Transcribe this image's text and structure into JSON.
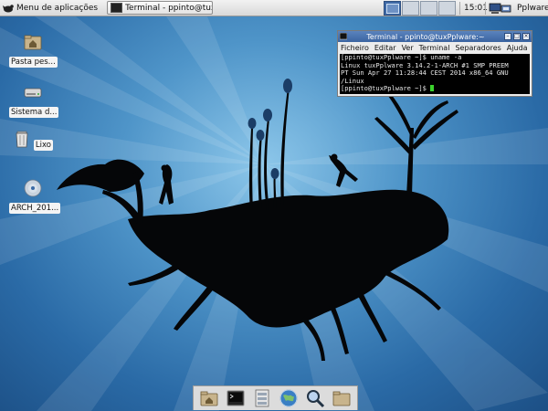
{
  "panel": {
    "app_menu_label": "Menu de aplicações",
    "task_label": "Terminal - ppinto@tuxPp...",
    "workspaces": [
      {
        "active": true
      },
      {
        "active": false
      },
      {
        "active": false
      },
      {
        "active": false
      }
    ],
    "clock": "15:01",
    "user": "Pplware"
  },
  "desktop_icons": [
    {
      "label": "Pasta pes...",
      "icon": "home-folder-icon"
    },
    {
      "label": "Sistema d...",
      "icon": "drive-icon"
    },
    {
      "label": "Lixo",
      "icon": "trash-icon"
    },
    {
      "label": "ARCH_201...",
      "icon": "cd-icon"
    }
  ],
  "terminal": {
    "title": "Terminal - ppinto@tuxPplware:~",
    "menu": [
      "Ficheiro",
      "Editar",
      "Ver",
      "Terminal",
      "Separadores",
      "Ajuda"
    ],
    "lines": [
      "[ppinto@tuxPplware ~]$ uname -a",
      "Linux tuxPplware 3.14.2-1-ARCH #1 SMP PREEM",
      "PT Sun Apr 27 11:28:44 CEST 2014 x86_64 GNU",
      "/Linux",
      "[ppinto@tuxPplware ~]$ "
    ]
  },
  "dock": [
    {
      "icon": "home-folder-icon"
    },
    {
      "icon": "terminal-icon"
    },
    {
      "icon": "file-manager-icon"
    },
    {
      "icon": "web-browser-icon"
    },
    {
      "icon": "search-icon"
    },
    {
      "icon": "folder-icon"
    }
  ],
  "colors": {
    "panel": "#e4e4e4",
    "titlebar": "#4a74b0",
    "cursor": "#3bd22c",
    "wallpaper": "#3a7ab5"
  }
}
